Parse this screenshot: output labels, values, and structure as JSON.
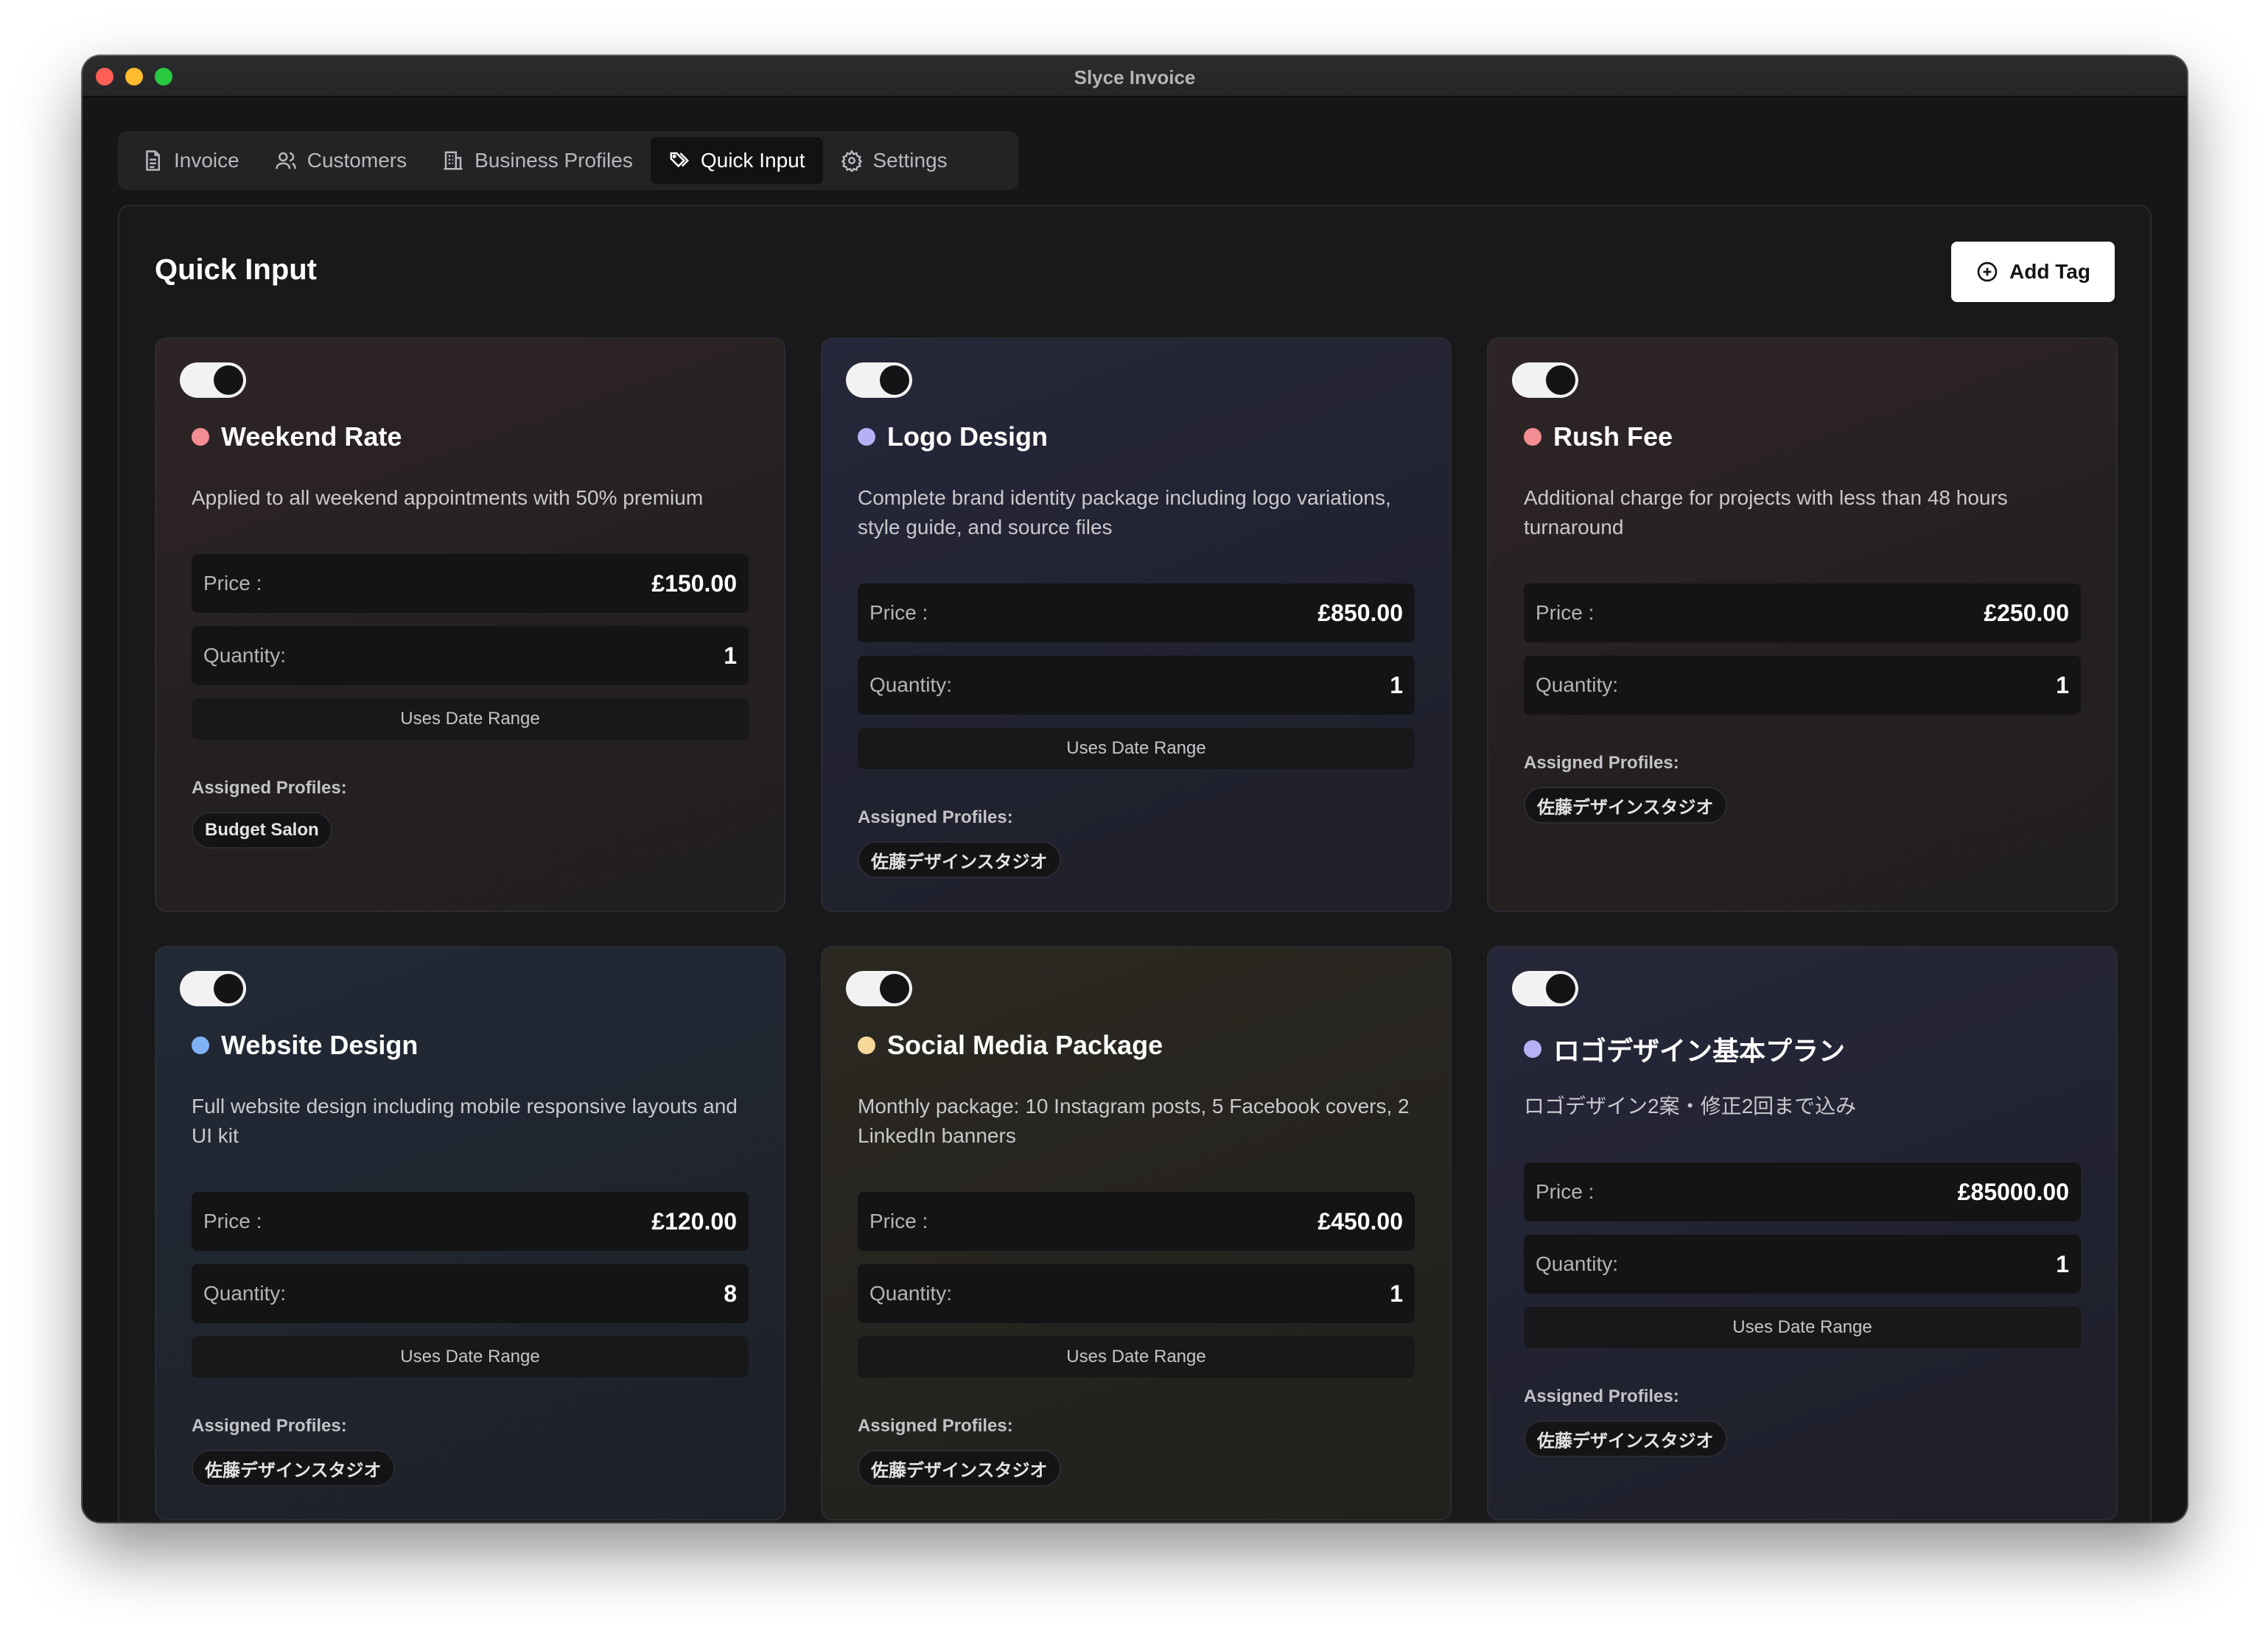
{
  "window": {
    "title": "Slyce Invoice"
  },
  "tabs": [
    {
      "label": "Invoice",
      "icon": "document-icon",
      "active": false
    },
    {
      "label": "Customers",
      "icon": "users-icon",
      "active": false
    },
    {
      "label": "Business Profiles",
      "icon": "building-icon",
      "active": false
    },
    {
      "label": "Quick Input",
      "icon": "tags-icon",
      "active": true
    },
    {
      "label": "Settings",
      "icon": "gear-icon",
      "active": false
    }
  ],
  "page": {
    "title": "Quick Input",
    "add_button_label": "Add Tag"
  },
  "colors": {
    "pink_dot": "#f48c94",
    "purple_dot": "#b6b1f5",
    "blue_dot": "#7fb2f5",
    "amber_dot": "#f5d89a"
  },
  "labels": {
    "price": "Price :",
    "quantity": "Quantity:",
    "date_range": "Uses Date Range",
    "assigned": "Assigned Profiles:"
  },
  "cards": [
    {
      "title": "Weekend Rate",
      "dot_color": "#f48c94",
      "description": "Applied to all weekend appointments with 50% premium",
      "price": "£150.00",
      "quantity": "1",
      "uses_date_range": true,
      "enabled": true,
      "profiles": [
        "Budget Salon"
      ]
    },
    {
      "title": "Logo Design",
      "dot_color": "#b6b1f5",
      "description": "Complete brand identity package including logo variations, style guide, and source files",
      "price": "£850.00",
      "quantity": "1",
      "uses_date_range": true,
      "enabled": true,
      "profiles": [
        "佐藤デザインスタジオ"
      ]
    },
    {
      "title": "Rush Fee",
      "dot_color": "#f48c94",
      "description": "Additional charge for projects with less than 48 hours turnaround",
      "price": "£250.00",
      "quantity": "1",
      "uses_date_range": false,
      "enabled": true,
      "profiles": [
        "佐藤デザインスタジオ"
      ]
    },
    {
      "title": "Website Design",
      "dot_color": "#7fb2f5",
      "description": "Full website design including mobile responsive layouts and UI kit",
      "price": "£120.00",
      "quantity": "8",
      "uses_date_range": true,
      "enabled": true,
      "profiles": [
        "佐藤デザインスタジオ"
      ]
    },
    {
      "title": "Social Media Package",
      "dot_color": "#f5d89a",
      "description": "Monthly package: 10 Instagram posts, 5 Facebook covers, 2 LinkedIn banners",
      "price": "£450.00",
      "quantity": "1",
      "uses_date_range": true,
      "enabled": true,
      "profiles": [
        "佐藤デザインスタジオ"
      ]
    },
    {
      "title": "ロゴデザイン基本プラン",
      "dot_color": "#b6b1f5",
      "description": "ロゴデザイン2案・修正2回まで込み",
      "price": "£85000.00",
      "quantity": "1",
      "uses_date_range": true,
      "enabled": true,
      "profiles": [
        "佐藤デザインスタジオ"
      ]
    }
  ]
}
